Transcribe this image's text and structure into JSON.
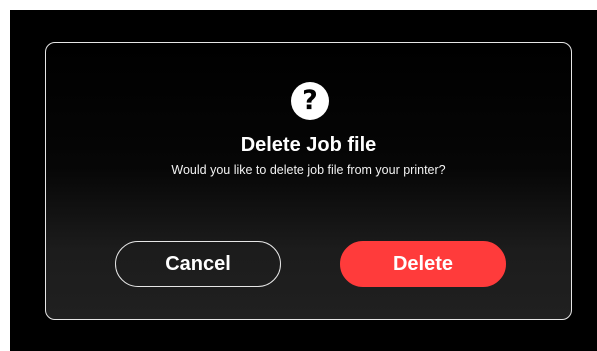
{
  "dialog": {
    "icon": "question-mark-icon",
    "icon_glyph": "?",
    "title": "Delete Job file",
    "message": "Would you like to delete job file from your printer?",
    "cancel_label": "Cancel",
    "delete_label": "Delete"
  },
  "colors": {
    "background": "#000000",
    "accent_danger": "#ff3b3b",
    "text": "#ffffff",
    "dialog_border": "#e6e6e6"
  }
}
